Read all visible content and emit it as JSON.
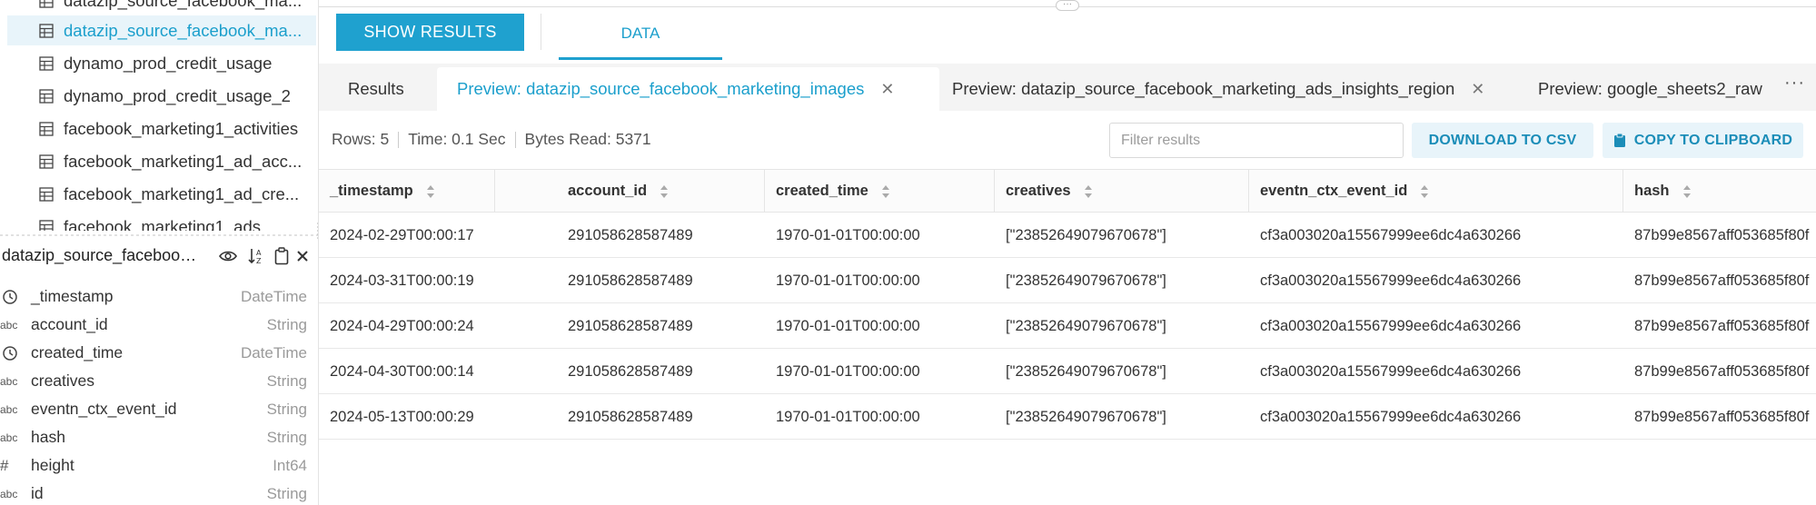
{
  "sidebar": {
    "tables": [
      {
        "label": "datazip_source_facebook_ma...",
        "active": false
      },
      {
        "label": "datazip_source_facebook_ma...",
        "active": true
      },
      {
        "label": "dynamo_prod_credit_usage",
        "active": false
      },
      {
        "label": "dynamo_prod_credit_usage_2",
        "active": false
      },
      {
        "label": "facebook_marketing1_activities",
        "active": false
      },
      {
        "label": "facebook_marketing1_ad_acc...",
        "active": false
      },
      {
        "label": "facebook_marketing1_ad_cre...",
        "active": false
      },
      {
        "label": "facebook_marketing1_ads",
        "active": false
      }
    ],
    "schema_title": "datazip_source_facebook_...",
    "fields": [
      {
        "icon": "clock-icon",
        "name": "_timestamp",
        "type": "DateTime"
      },
      {
        "icon": "abc",
        "name": "account_id",
        "type": "String"
      },
      {
        "icon": "clock-icon",
        "name": "created_time",
        "type": "DateTime"
      },
      {
        "icon": "abc",
        "name": "creatives",
        "type": "String"
      },
      {
        "icon": "abc",
        "name": "eventn_ctx_event_id",
        "type": "String"
      },
      {
        "icon": "abc",
        "name": "hash",
        "type": "String"
      },
      {
        "icon": "#",
        "name": "height",
        "type": "Int64"
      },
      {
        "icon": "abc",
        "name": "id",
        "type": "String"
      }
    ]
  },
  "toolbar": {
    "show_results": "SHOW RESULTS",
    "data_tab": "DATA"
  },
  "preview_tabs": [
    {
      "label": "Results",
      "closable": false,
      "active": false
    },
    {
      "label": "Preview: datazip_source_facebook_marketing_images",
      "closable": true,
      "active": true
    },
    {
      "label": "Preview: datazip_source_facebook_marketing_ads_insights_region",
      "closable": true,
      "active": false
    },
    {
      "label": "Preview: google_sheets2_raw",
      "closable": false,
      "active": false
    }
  ],
  "stats": {
    "rows": "Rows: 5",
    "time": "Time: 0.1 Sec",
    "bytes": "Bytes Read: 5371"
  },
  "filter": {
    "placeholder": "Filter results",
    "value": ""
  },
  "actions": {
    "download": "DOWNLOAD TO CSV",
    "copy": "COPY TO CLIPBOARD"
  },
  "table": {
    "columns": [
      "_timestamp",
      "account_id",
      "created_time",
      "creatives",
      "eventn_ctx_event_id",
      "hash"
    ],
    "rows": [
      [
        "2024-02-29T00:00:17",
        "291058628587489",
        "1970-01-01T00:00:00",
        "[\"23852649079670678\"]",
        "cf3a003020a15567999ee6dc4a630266",
        "87b99e8567aff053685f80f"
      ],
      [
        "2024-03-31T00:00:19",
        "291058628587489",
        "1970-01-01T00:00:00",
        "[\"23852649079670678\"]",
        "cf3a003020a15567999ee6dc4a630266",
        "87b99e8567aff053685f80f"
      ],
      [
        "2024-04-29T00:00:24",
        "291058628587489",
        "1970-01-01T00:00:00",
        "[\"23852649079670678\"]",
        "cf3a003020a15567999ee6dc4a630266",
        "87b99e8567aff053685f80f"
      ],
      [
        "2024-04-30T00:00:14",
        "291058628587489",
        "1970-01-01T00:00:00",
        "[\"23852649079670678\"]",
        "cf3a003020a15567999ee6dc4a630266",
        "87b99e8567aff053685f80f"
      ],
      [
        "2024-05-13T00:00:29",
        "291058628587489",
        "1970-01-01T00:00:00",
        "[\"23852649079670678\"]",
        "cf3a003020a15567999ee6dc4a630266",
        "87b99e8567aff053685f80f"
      ]
    ]
  },
  "colors": {
    "accent": "#1fa1cf",
    "accent_text": "#1b9fcc",
    "active_bg": "#e8f4fa"
  }
}
